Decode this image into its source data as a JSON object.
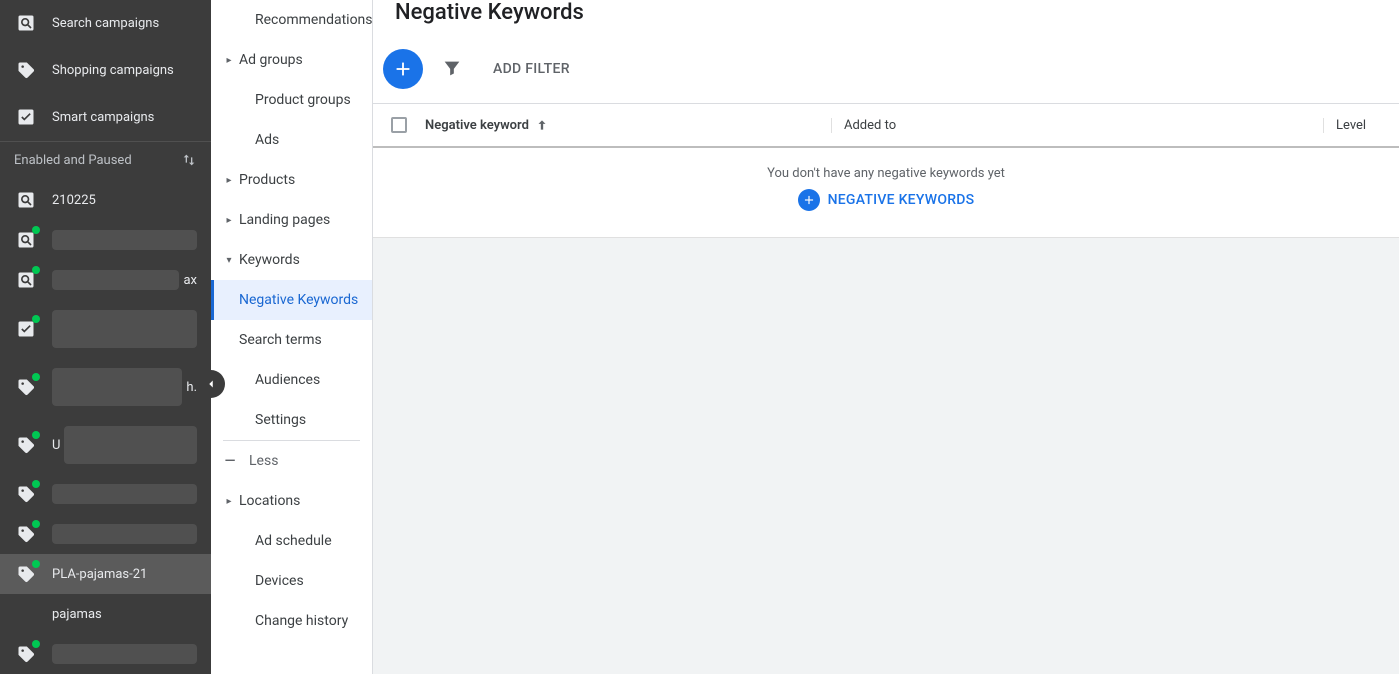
{
  "page_title": "Negative Keywords",
  "left_nav": {
    "categories": [
      {
        "label": "Search campaigns",
        "icon": "search-box-icon"
      },
      {
        "label": "Shopping campaigns",
        "icon": "tag-icon"
      },
      {
        "label": "Smart campaigns",
        "icon": "tools-icon"
      }
    ],
    "filter_label": "Enabled and Paused",
    "campaigns": [
      {
        "id": "c0",
        "label": "210225",
        "icon": "search-box-icon",
        "status": false,
        "tall": false,
        "blur": false
      },
      {
        "id": "c1",
        "label": "",
        "icon": "search-box-icon",
        "status": true,
        "tall": false,
        "blur": true
      },
      {
        "id": "c2",
        "label": "ax",
        "icon": "search-box-icon",
        "status": true,
        "tall": false,
        "blur": true,
        "suffix": "ax"
      },
      {
        "id": "c3",
        "label": "",
        "icon": "tools-icon",
        "status": true,
        "tall": true,
        "blur": true
      },
      {
        "id": "c4",
        "label": "h.",
        "icon": "tag-icon",
        "status": true,
        "tall": true,
        "blur": true,
        "suffix": "h."
      },
      {
        "id": "c5",
        "label": "U",
        "icon": "tag-icon",
        "status": true,
        "tall": true,
        "blur": true,
        "prefix": "U"
      },
      {
        "id": "c6",
        "label": "",
        "icon": "tag-icon",
        "status": true,
        "tall": false,
        "blur": true
      },
      {
        "id": "c7",
        "label": "",
        "icon": "tag-icon",
        "status": true,
        "tall": false,
        "blur": true
      },
      {
        "id": "c8",
        "label": "PLA-pajamas-21",
        "icon": "tag-icon",
        "status": true,
        "tall": false,
        "blur": false,
        "selected": true
      },
      {
        "id": "c9",
        "label": "",
        "icon": "tag-icon",
        "status": true,
        "tall": false,
        "blur": true
      }
    ],
    "sub_item": "pajamas"
  },
  "sub_nav": {
    "items": [
      {
        "label": "Recommendations",
        "type": "plain"
      },
      {
        "label": "Ad groups",
        "type": "collapsed"
      },
      {
        "label": "Product groups",
        "type": "plain"
      },
      {
        "label": "Ads",
        "type": "plain"
      },
      {
        "label": "Products",
        "type": "collapsed"
      },
      {
        "label": "Landing pages",
        "type": "collapsed"
      },
      {
        "label": "Keywords",
        "type": "expanded",
        "children": [
          {
            "label": "Negative Keywords",
            "active": true
          },
          {
            "label": "Search terms",
            "active": false
          }
        ]
      },
      {
        "label": "Audiences",
        "type": "plain"
      },
      {
        "label": "Settings",
        "type": "plain"
      },
      {
        "label": "Less",
        "type": "less"
      },
      {
        "label": "Locations",
        "type": "collapsed"
      },
      {
        "label": "Ad schedule",
        "type": "plain"
      },
      {
        "label": "Devices",
        "type": "plain"
      },
      {
        "label": "Change history",
        "type": "plain"
      }
    ]
  },
  "toolbar": {
    "add_filter_label": "ADD FILTER"
  },
  "table": {
    "columns": {
      "neg": "Negative keyword",
      "added": "Added to",
      "level": "Level"
    }
  },
  "empty_state": {
    "message": "You don't have any negative keywords yet",
    "cta": "NEGATIVE KEYWORDS"
  }
}
